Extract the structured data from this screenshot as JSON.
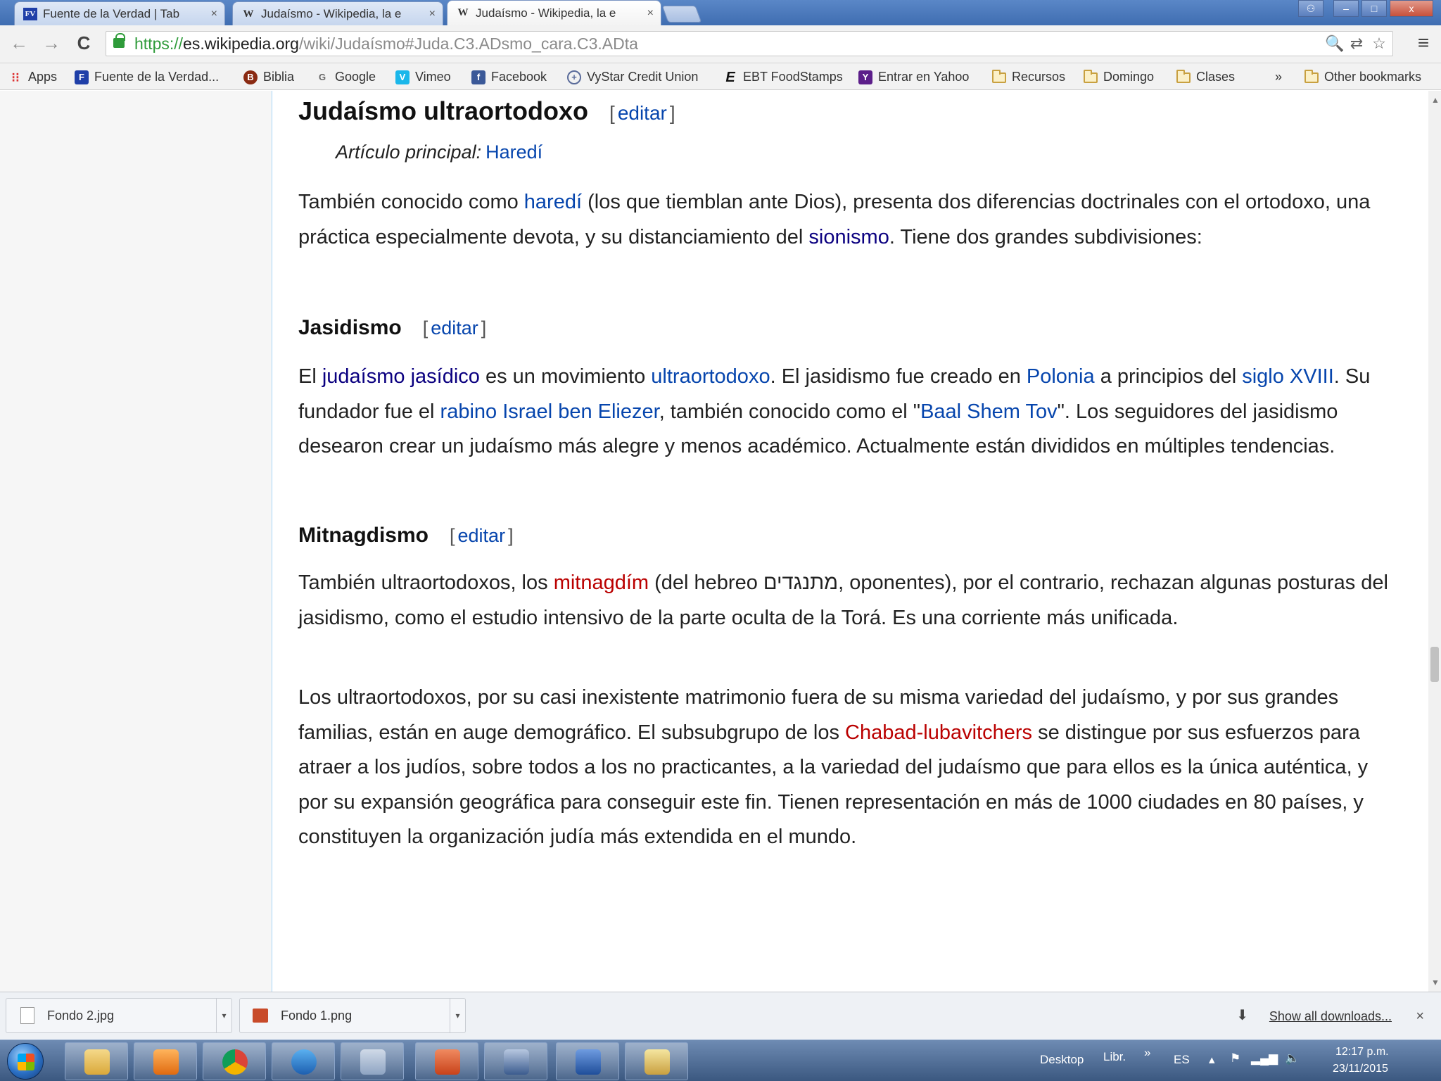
{
  "browser": {
    "tabs": [
      {
        "title": "Fuente de la Verdad | Tab",
        "favicon": "FV",
        "close": "×"
      },
      {
        "title": "Judaísmo - Wikipedia, la e",
        "favicon": "W",
        "close": "×"
      },
      {
        "title": "Judaísmo - Wikipedia, la e",
        "favicon": "W",
        "close": "×"
      }
    ],
    "window_buttons": {
      "minimize": "–",
      "maximize": "□",
      "close": "x"
    },
    "nav": {
      "back": "←",
      "forward": "→",
      "reload": "C"
    },
    "url": {
      "scheme": "https://",
      "host": "es.wikipedia.org",
      "path": "/wiki/Judaísmo#Juda.C3.ADsmo_cara.C3.ADta"
    },
    "omnibox_icons": {
      "zoom": "🔍",
      "translate": "⇄",
      "star": "☆"
    },
    "menu": "≡",
    "bookmarks": [
      {
        "label": "Apps",
        "icon": "apps-icon"
      },
      {
        "label": "Fuente de la Verdad...",
        "icon": "fdv-icon"
      },
      {
        "label": "Biblia",
        "icon": "biblia-icon"
      },
      {
        "label": "Google",
        "icon": "google-icon"
      },
      {
        "label": "Vimeo",
        "icon": "vimeo-icon"
      },
      {
        "label": "Facebook",
        "icon": "facebook-icon"
      },
      {
        "label": "VyStar Credit Union",
        "icon": "vystar-icon"
      },
      {
        "label": "EBT FoodStamps",
        "icon": "ebt-icon"
      },
      {
        "label": "Entrar en Yahoo",
        "icon": "yahoo-icon"
      },
      {
        "label": "Recursos",
        "icon": "folder-icon"
      },
      {
        "label": "Domingo",
        "icon": "folder-icon"
      },
      {
        "label": "Clases",
        "icon": "folder-icon"
      },
      {
        "label": "»",
        "icon": "overflow-icon"
      },
      {
        "label": "Other bookmarks",
        "icon": "folder-icon"
      }
    ]
  },
  "article": {
    "heading": "Judaísmo ultraortodoxo",
    "edit_label": "editar",
    "hatnote": {
      "label": "Artículo principal:",
      "link": "Haredí"
    },
    "intro": {
      "t1": "También conocido como ",
      "l1": "haredí",
      "t2": " (los que tiemblan ante Dios), presenta dos diferencias doctrinales con el ortodoxo, una práctica especialmente devota, y su distanciamiento del ",
      "l2": "sionismo",
      "t3": ". Tiene dos grandes subdivisiones:"
    },
    "jasidismo": {
      "heading": "Jasidismo",
      "t1": "El ",
      "l1": "judaísmo jasídico",
      "t2": " es un movimiento ",
      "l2": "ultraortodoxo",
      "t3": ". El jasidismo fue creado en ",
      "l3": "Polonia",
      "t4": " a principios del ",
      "l4": "siglo XVIII",
      "t5": ". Su fundador fue el ",
      "l5": "rabino Israel ben Eliezer",
      "t6": ", también conocido como el \"",
      "l6": "Baal Shem Tov",
      "t7": "\". Los seguidores del jasidismo desearon crear un judaísmo más alegre y menos académico. Actualmente están divididos en múltiples tendencias."
    },
    "mitnagdismo": {
      "heading": "Mitnagdismo",
      "t1": "También ultraortodoxos, los ",
      "l1": "mitnagdím",
      "t2": " (del hebreo מתנגדים, oponentes), por el contrario, rechazan algunas posturas del jasidismo, como el estudio intensivo de la parte oculta de la Torá. Es una corriente más unificada."
    },
    "closing": {
      "t1": "Los ultraortodoxos, por su casi inexistente matrimonio fuera de su misma variedad del judaísmo, y por sus grandes familias, están en auge demográfico. El subsubgrupo de los ",
      "l1": "Chabad-lubavitchers",
      "t2": " se distingue por sus esfuerzos para atraer a los judíos, sobre todos a los no practicantes, a la variedad del judaísmo que para ellos es la única auténtica, y por su expansión geográfica para conseguir este fin. Tienen representación en más de 1000 ciudades en 80 países, y constituyen la organización judía más extendida en el mundo."
    }
  },
  "downloads": {
    "items": [
      {
        "name": "Fondo 2.jpg"
      },
      {
        "name": "Fondo 1.png"
      }
    ],
    "show_all": "Show all downloads...",
    "close": "×"
  },
  "taskbar": {
    "apps": [
      "explorer-icon",
      "media-player-icon",
      "chrome-icon",
      "edge-icon",
      "calculator-icon",
      "powerpoint-icon",
      "presentation-icon",
      "word-icon",
      "paint-icon"
    ],
    "desktop_label": "Desktop",
    "libraries_label": "Libr.",
    "overflow": "»",
    "lang": "ES",
    "time": "12:17 p.m.",
    "date": "23/11/2015"
  },
  "colors": {
    "link": "#0645ad",
    "visited_link": "#0b0080",
    "new_link": "#ba0000"
  }
}
